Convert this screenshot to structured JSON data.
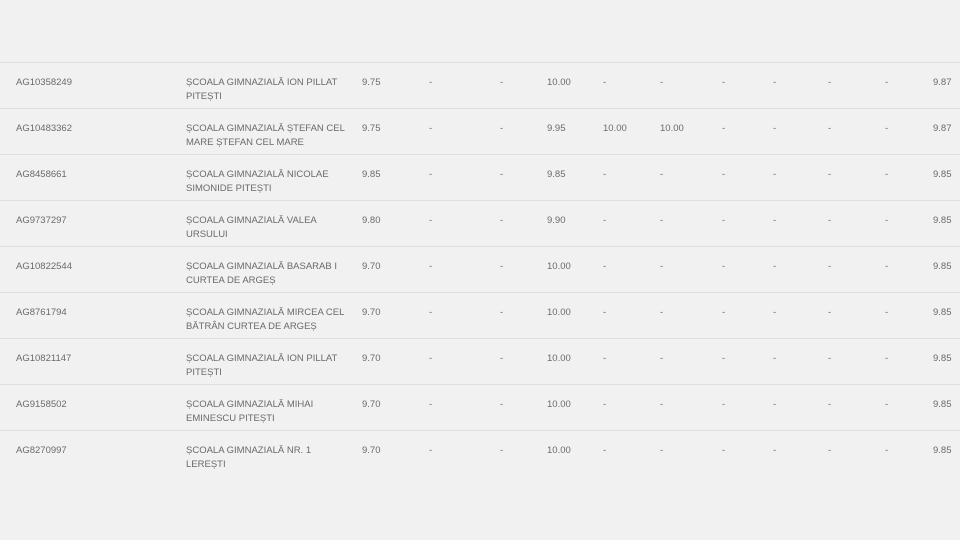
{
  "rows": [
    {
      "code": "AG10358249",
      "school": "ȘCOALA GIMNAZIALĂ ION PILLAT PITEȘTI",
      "v": [
        "9.75",
        "-",
        "-",
        "10.00",
        "-",
        "-",
        "-",
        "-",
        "-",
        "-"
      ],
      "avg": "9.87"
    },
    {
      "code": "AG10483362",
      "school": "ȘCOALA GIMNAZIALĂ ȘTEFAN CEL MARE ȘTEFAN CEL MARE",
      "v": [
        "9.75",
        "-",
        "-",
        "9.95",
        "10.00",
        "10.00",
        "-",
        "-",
        "-",
        "-"
      ],
      "avg": "9.87"
    },
    {
      "code": "AG8458661",
      "school": "ȘCOALA GIMNAZIALĂ NICOLAE SIMONIDE PITEȘTI",
      "v": [
        "9.85",
        "-",
        "-",
        "9.85",
        "-",
        "-",
        "-",
        "-",
        "-",
        "-"
      ],
      "avg": "9.85"
    },
    {
      "code": "AG9737297",
      "school": "ȘCOALA GIMNAZIALĂ VALEA URSULUI",
      "v": [
        "9.80",
        "-",
        "-",
        "9.90",
        "-",
        "-",
        "-",
        "-",
        "-",
        "-"
      ],
      "avg": "9.85"
    },
    {
      "code": "AG10822544",
      "school": "ȘCOALA GIMNAZIALĂ BASARAB I CURTEA DE ARGEȘ",
      "v": [
        "9.70",
        "-",
        "-",
        "10.00",
        "-",
        "-",
        "-",
        "-",
        "-",
        "-"
      ],
      "avg": "9.85"
    },
    {
      "code": "AG8761794",
      "school": "ȘCOALA GIMNAZIALĂ MIRCEA CEL BĂTRÂN CURTEA DE ARGEȘ",
      "v": [
        "9.70",
        "-",
        "-",
        "10.00",
        "-",
        "-",
        "-",
        "-",
        "-",
        "-"
      ],
      "avg": "9.85"
    },
    {
      "code": "AG10821147",
      "school": "ȘCOALA GIMNAZIALĂ ION PILLAT PITEȘTI",
      "v": [
        "9.70",
        "-",
        "-",
        "10.00",
        "-",
        "-",
        "-",
        "-",
        "-",
        "-"
      ],
      "avg": "9.85"
    },
    {
      "code": "AG9158502",
      "school": "ȘCOALA GIMNAZIALĂ MIHAI EMINESCU PITEȘTI",
      "v": [
        "9.70",
        "-",
        "-",
        "10.00",
        "-",
        "-",
        "-",
        "-",
        "-",
        "-"
      ],
      "avg": "9.85"
    },
    {
      "code": "AG8270997",
      "school": "ȘCOALA GIMNAZIALĂ NR. 1 LEREȘTI",
      "v": [
        "9.70",
        "-",
        "-",
        "10.00",
        "-",
        "-",
        "-",
        "-",
        "-",
        "-"
      ],
      "avg": "9.85"
    }
  ]
}
